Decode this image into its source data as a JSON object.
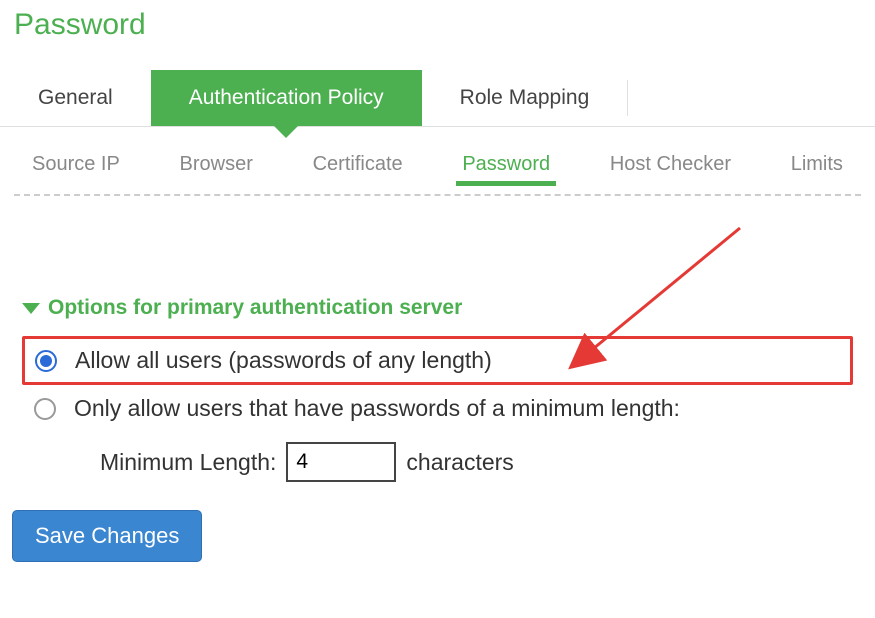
{
  "page": {
    "title": "Password"
  },
  "tabs1": [
    {
      "label": "General",
      "active": false
    },
    {
      "label": "Authentication Policy",
      "active": true
    },
    {
      "label": "Role Mapping",
      "active": false
    }
  ],
  "tabs2": [
    {
      "label": "Source IP",
      "active": false
    },
    {
      "label": "Browser",
      "active": false
    },
    {
      "label": "Certificate",
      "active": false
    },
    {
      "label": "Password",
      "active": true
    },
    {
      "label": "Host Checker",
      "active": false
    },
    {
      "label": "Limits",
      "active": false
    }
  ],
  "section": {
    "header": "Options for primary authentication server",
    "options": {
      "allow_all": {
        "label": "Allow all users (passwords of any length)",
        "selected": true
      },
      "only_min": {
        "label": "Only allow users that have passwords of a minimum length:",
        "selected": false
      }
    },
    "min_length_label": "Minimum Length:",
    "min_length_value": "4",
    "min_length_suffix": "characters"
  },
  "buttons": {
    "save": "Save Changes"
  },
  "annotation": {
    "arrow_color": "#e53935"
  }
}
